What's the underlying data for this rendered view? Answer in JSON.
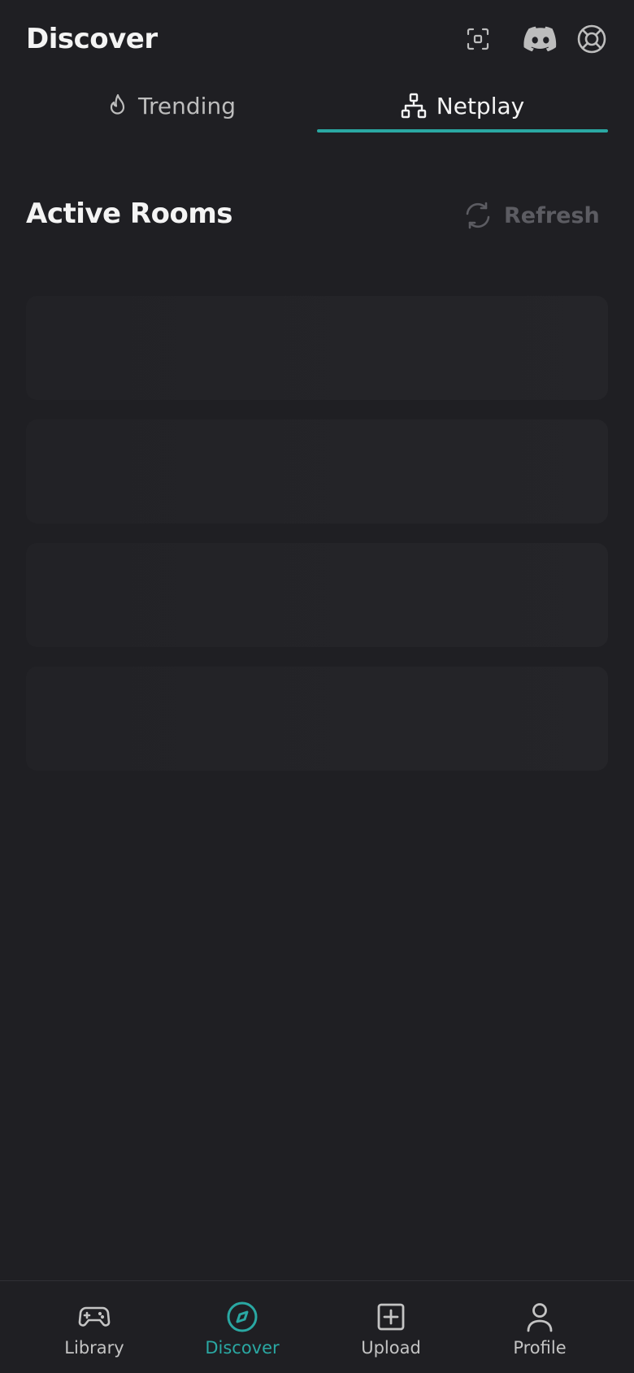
{
  "header": {
    "title": "Discover",
    "icons": [
      "scan-icon",
      "discord-icon",
      "help-lifebuoy-icon"
    ]
  },
  "tabs": [
    {
      "label": "Trending",
      "icon": "flame-icon",
      "active": false
    },
    {
      "label": "Netplay",
      "icon": "network-icon",
      "active": true
    }
  ],
  "section": {
    "title": "Active Rooms",
    "refresh_label": "Refresh"
  },
  "nav": [
    {
      "label": "Library",
      "icon": "gamepad-icon",
      "active": false
    },
    {
      "label": "Discover",
      "icon": "compass-icon",
      "active": true
    },
    {
      "label": "Upload",
      "icon": "plus-square-icon",
      "active": false
    },
    {
      "label": "Profile",
      "icon": "user-icon",
      "active": false
    }
  ],
  "colors": {
    "background": "#1f1f23",
    "accent": "#2aa8a3",
    "skeleton": "#232327"
  }
}
